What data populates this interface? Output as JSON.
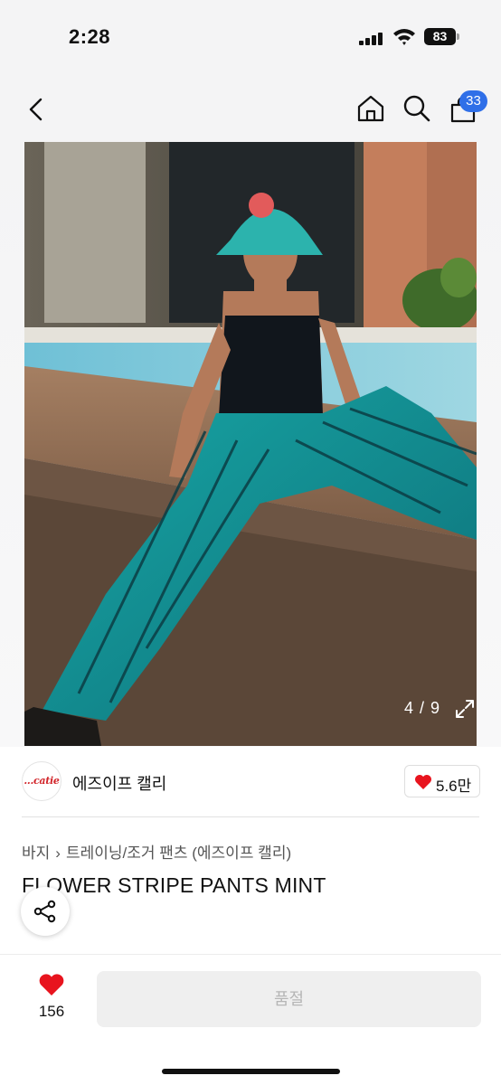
{
  "status_bar": {
    "time": "2:28",
    "battery": "83"
  },
  "nav": {
    "cart_count": "33",
    "icons": [
      "back-chevron-icon",
      "home-icon",
      "search-icon",
      "shopping-bag-icon"
    ]
  },
  "gallery": {
    "counter": "4 / 9",
    "expand_icon": "expand-arrows-icon"
  },
  "brand": {
    "logo_text": "...catie",
    "name": "에즈이프 캘리",
    "likes": "5.6만"
  },
  "product": {
    "breadcrumb": [
      "바지",
      "트레이닝/조거 팬츠 (에즈이프 캘리)"
    ],
    "title": "FLOWER STRIPE PANTS MINT"
  },
  "share": {
    "icon": "share-icon"
  },
  "bottom": {
    "wish_count": "156",
    "button_label": "품절"
  },
  "colors": {
    "accent_badge": "#2f6fe8",
    "heart": "#e8141e",
    "brand_red": "#d2262b"
  }
}
